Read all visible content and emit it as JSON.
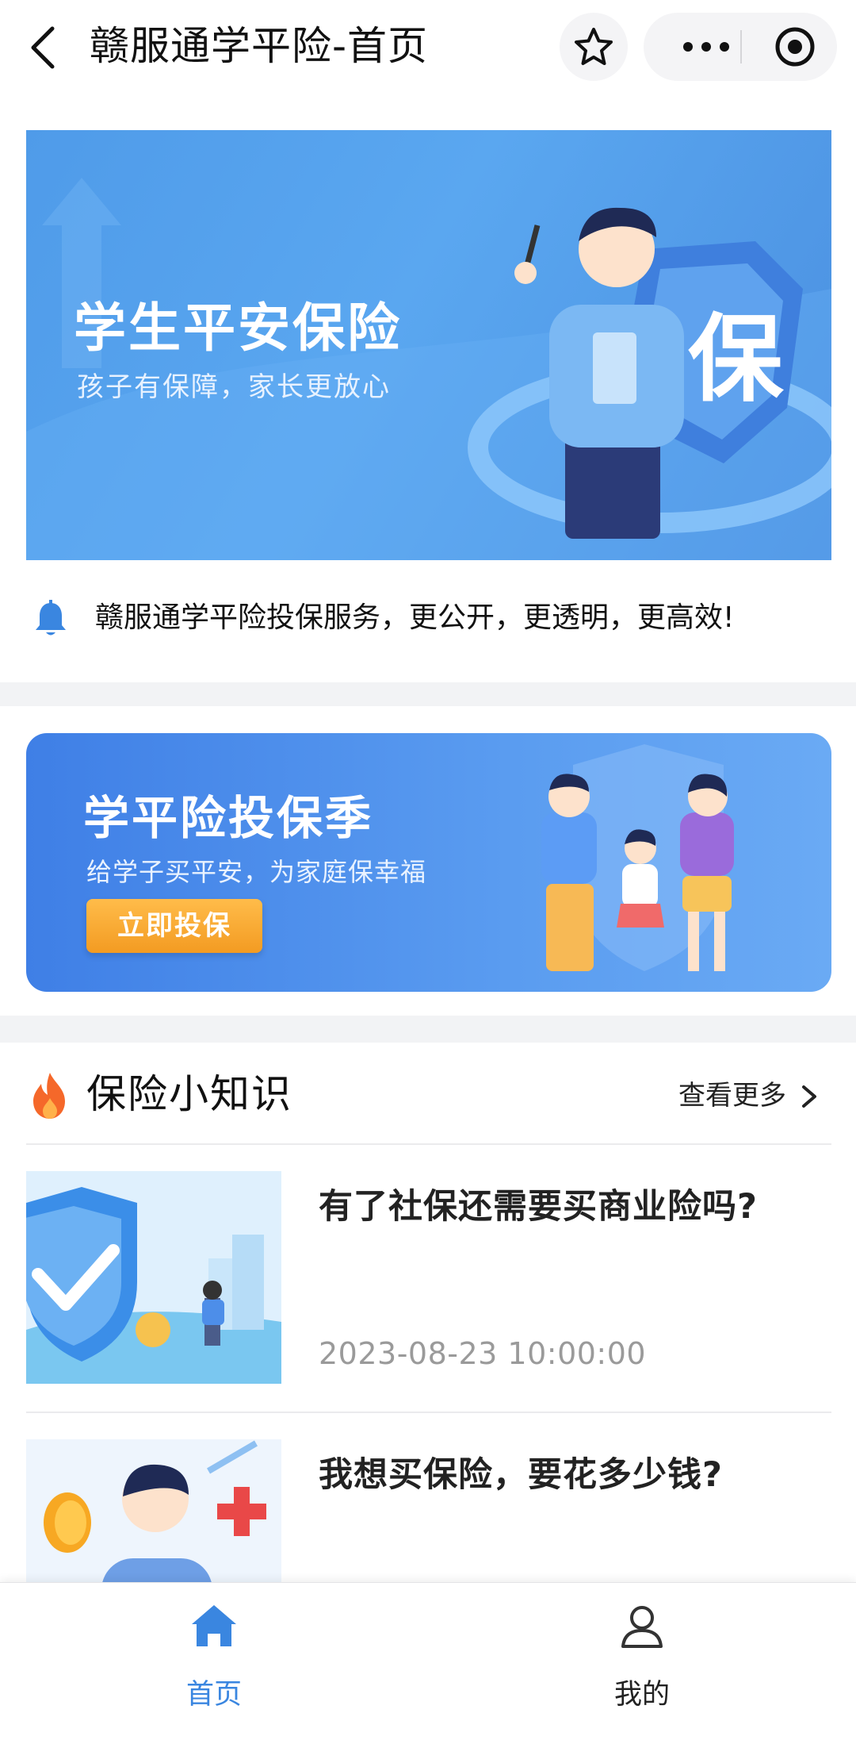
{
  "navbar": {
    "title": "赣服通学平险-首页",
    "back_icon": "chevron-left-icon",
    "star_icon": "star-outline-icon",
    "more_icon": "more-dots-icon",
    "close_icon": "target-circle-icon"
  },
  "hero": {
    "title": "学生平安保险",
    "subtitle": "孩子有保障，家长更放心",
    "shield_char": "保"
  },
  "notice": {
    "icon": "bell-icon",
    "text": "赣服通学平险投保服务，更公开，更透明，更高效!"
  },
  "promo": {
    "title": "学平险投保季",
    "subtitle": "给学子买平安，为家庭保幸福",
    "button_label": "立即投保"
  },
  "knowledge": {
    "icon": "fire-icon",
    "title": "保险小知识",
    "more_label": "查看更多",
    "articles": [
      {
        "title": "有了社保还需要买商业险吗?",
        "time": "2023-08-23 10:00:00"
      },
      {
        "title": "我想买保险，要花多少钱?",
        "time": ""
      }
    ]
  },
  "tabbar": {
    "tabs": [
      {
        "label": "首页",
        "icon": "home-icon",
        "active": true
      },
      {
        "label": "我的",
        "icon": "user-icon",
        "active": false
      }
    ],
    "active_color": "#3a86e0"
  }
}
